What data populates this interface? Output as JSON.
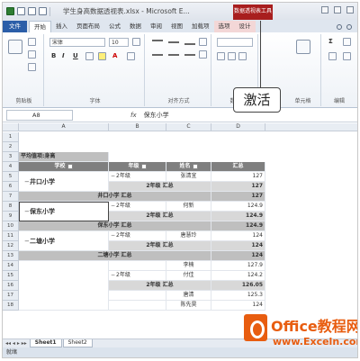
{
  "window": {
    "title": "学生身高数据透视表.xlsx - Microsoft E...",
    "context_tab_band": "数据透视表工具"
  },
  "tabs": [
    "文件",
    "开始",
    "插入",
    "页面布局",
    "公式",
    "数据",
    "审阅",
    "视图",
    "加载项",
    "选项",
    "设计"
  ],
  "ribbon": {
    "font_name": "宋体",
    "font_size": "10",
    "groups": [
      "剪贴板",
      "字体",
      "对齐方式",
      "数字",
      "单元格",
      "编辑"
    ]
  },
  "callout": "激活",
  "formula_bar": {
    "name_box": "A8",
    "fx": "fx",
    "value": "保东小学"
  },
  "columns": [
    "A",
    "B",
    "C",
    "D"
  ],
  "rows": [
    "1",
    "2",
    "3",
    "4",
    "5",
    "6",
    "7",
    "8",
    "9",
    "10",
    "11",
    "12",
    "13",
    "14",
    "15",
    "16",
    "17",
    "18"
  ],
  "pivot": {
    "filter_label": "平均值项:身高",
    "header": {
      "school": "学校",
      "grade": "年级",
      "name": "姓名",
      "total": "汇总"
    },
    "school_1": "井口小学",
    "school_2": "保东小学",
    "school_3": "二塘小学",
    "r5": {
      "grade": "2年级",
      "name": "张清宜",
      "value": "127"
    },
    "r6": {
      "label": "2年级 汇总",
      "value": "127"
    },
    "r7": {
      "label": "井口小学 汇总",
      "value": "127"
    },
    "r8": {
      "grade": "2年级",
      "name": "何新",
      "value": "124.9"
    },
    "r9": {
      "label": "2年级 汇总",
      "value": "124.9"
    },
    "r10": {
      "label": "保东小学 汇总",
      "value": "124.9"
    },
    "r11": {
      "grade": "2年级",
      "name": "唐慧玲",
      "value": "124"
    },
    "r12": {
      "label": "2年级 汇总",
      "value": "124"
    },
    "r13": {
      "label": "二塘小学 汇总",
      "value": "124"
    },
    "r14": {
      "name": "李楠",
      "value": "127.9"
    },
    "r15": {
      "grade": "2年级",
      "name": "付佳",
      "value": "124.2"
    },
    "r16": {
      "label": "2年级 汇总",
      "value": "126.05"
    },
    "r17": {
      "name": "唐清",
      "value": "125.3"
    },
    "r18": {
      "name": "陈先昊",
      "value": "124"
    }
  },
  "sheets": [
    "Sheet1",
    "Sheet2"
  ],
  "status": "就绪",
  "watermark": {
    "line1": "Office教程网",
    "line2": "www.Exceln.com"
  }
}
